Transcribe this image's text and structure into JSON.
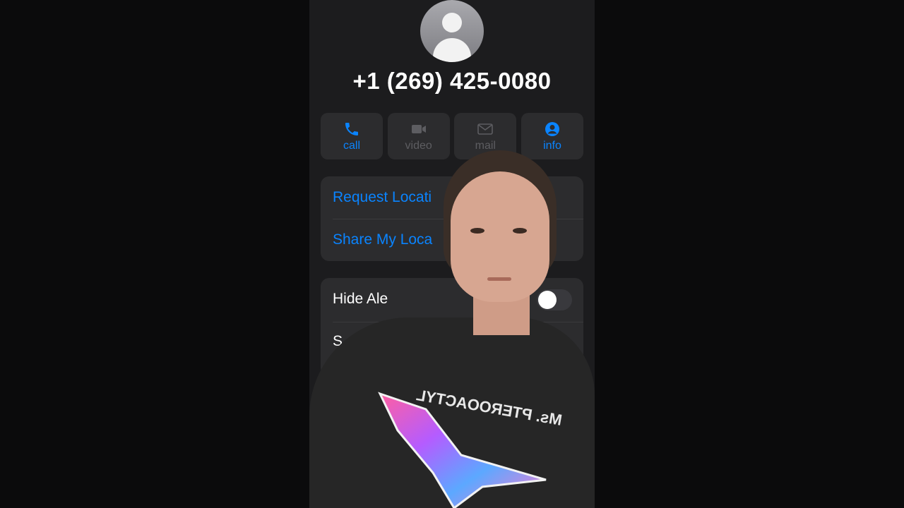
{
  "contact": {
    "phone_number": "+1 (269) 425-0080",
    "avatar_icon": "person-silhouette-icon"
  },
  "actions": [
    {
      "label": "call",
      "icon": "phone-icon",
      "enabled": true
    },
    {
      "label": "video",
      "icon": "video-camera-icon",
      "enabled": false
    },
    {
      "label": "mail",
      "icon": "envelope-icon",
      "enabled": false
    },
    {
      "label": "info",
      "icon": "person-circle-icon",
      "enabled": true
    }
  ],
  "location_card": {
    "request_location": "Request Locati",
    "share_location": "Share My Loca"
  },
  "alerts_card": {
    "hide_alerts": "Hide Ale",
    "second_row": "S",
    "hide_alerts_toggle": false
  },
  "overlay": {
    "shirt_text": "Ms. PTEROOACTYL"
  },
  "colors": {
    "accent": "#0a84ff",
    "card": "#2c2c2e",
    "background": "#1c1c1e"
  }
}
